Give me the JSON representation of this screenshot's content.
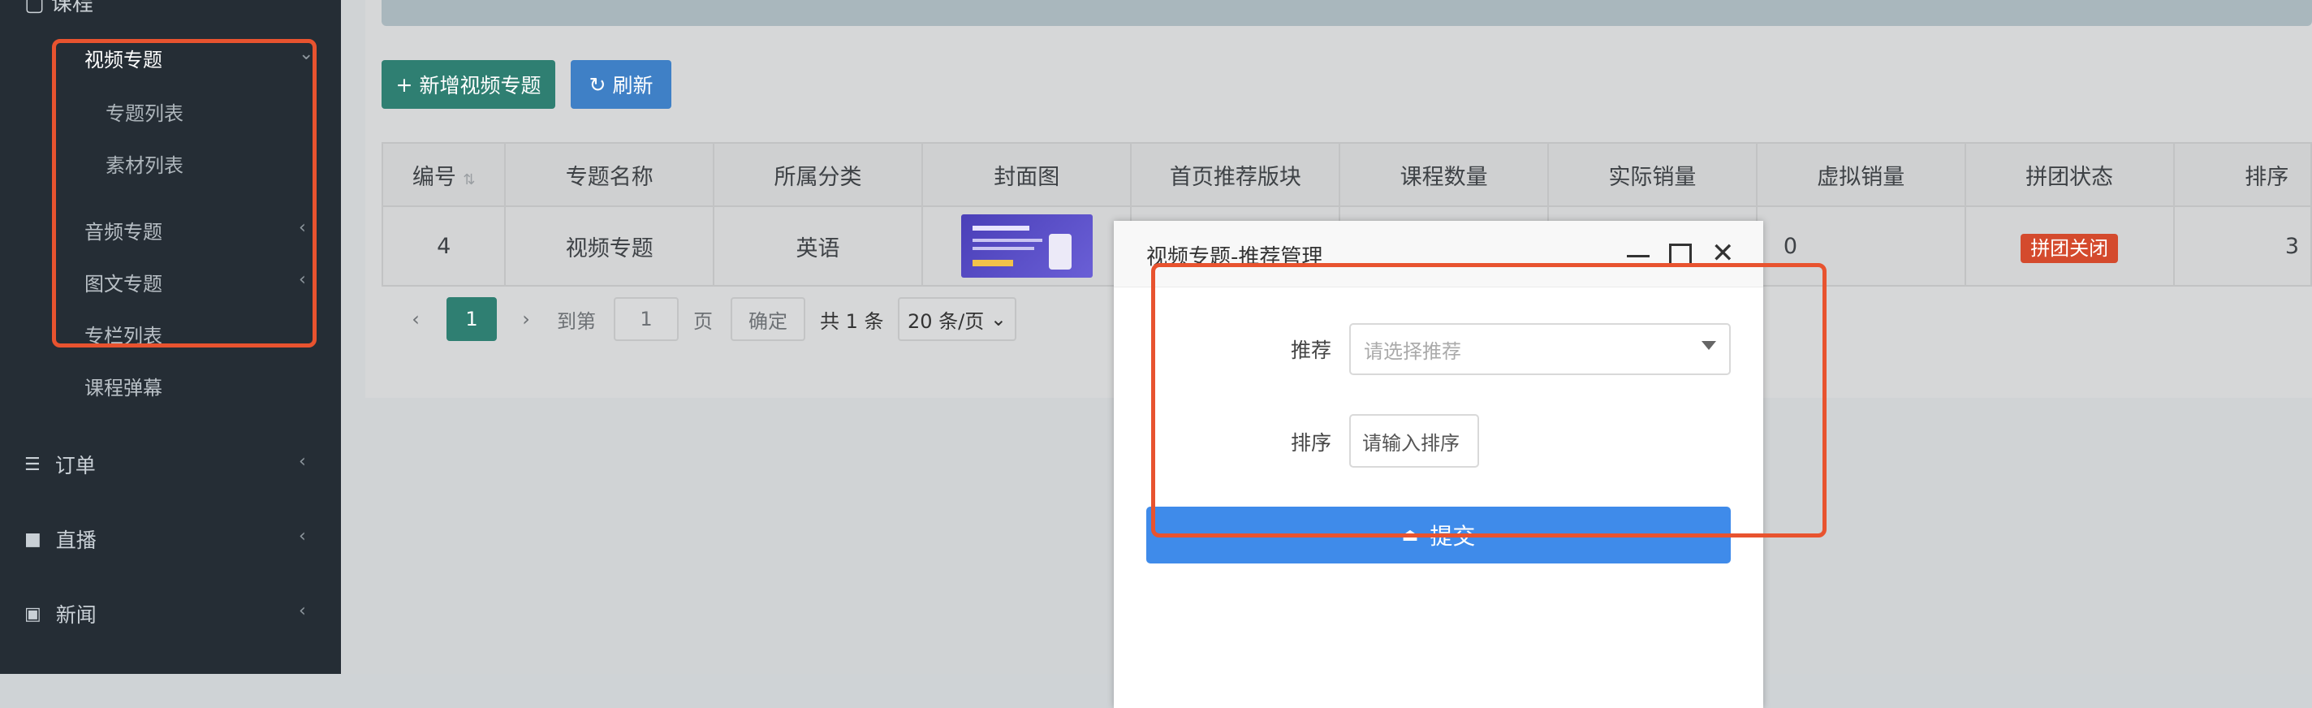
{
  "sidebar": {
    "top_item": "课程",
    "video_special": "视频专题",
    "special_list": "专题列表",
    "material_list": "素材列表",
    "audio_special": "音频专题",
    "image_text_special": "图文专题",
    "column_list": "专栏列表",
    "course_barrage": "课程弹幕",
    "orders": "订单",
    "live": "直播",
    "news": "新闻"
  },
  "toolbar": {
    "add_label": "新增视频专题",
    "refresh_label": "刷新"
  },
  "table": {
    "headers": [
      "编号",
      "专题名称",
      "所属分类",
      "封面图",
      "首页推荐版块",
      "课程数量",
      "实际销量",
      "虚拟销量",
      "拼团状态",
      "排序"
    ],
    "row": {
      "id": "4",
      "name": "视频专题",
      "category": "英语",
      "virtual_sales": "0",
      "group_status": "拼团关闭",
      "sort": "3"
    }
  },
  "pagination": {
    "current_page": "1",
    "goto_label": "到第",
    "goto_value": "1",
    "page_label": "页",
    "confirm_label": "确定",
    "total_label": "共 1 条",
    "page_size": "20 条/页"
  },
  "modal": {
    "title": "视频专题-推荐管理",
    "recommend_label": "推荐",
    "recommend_placeholder": "请选择推荐",
    "sort_label": "排序",
    "sort_placeholder": "请输入排序",
    "submit_label": "提交"
  },
  "colors": {
    "accent_green": "#2f7f72",
    "accent_blue": "#3f80c6",
    "submit_blue": "#3f8bea",
    "highlight_red": "#e8532f"
  }
}
